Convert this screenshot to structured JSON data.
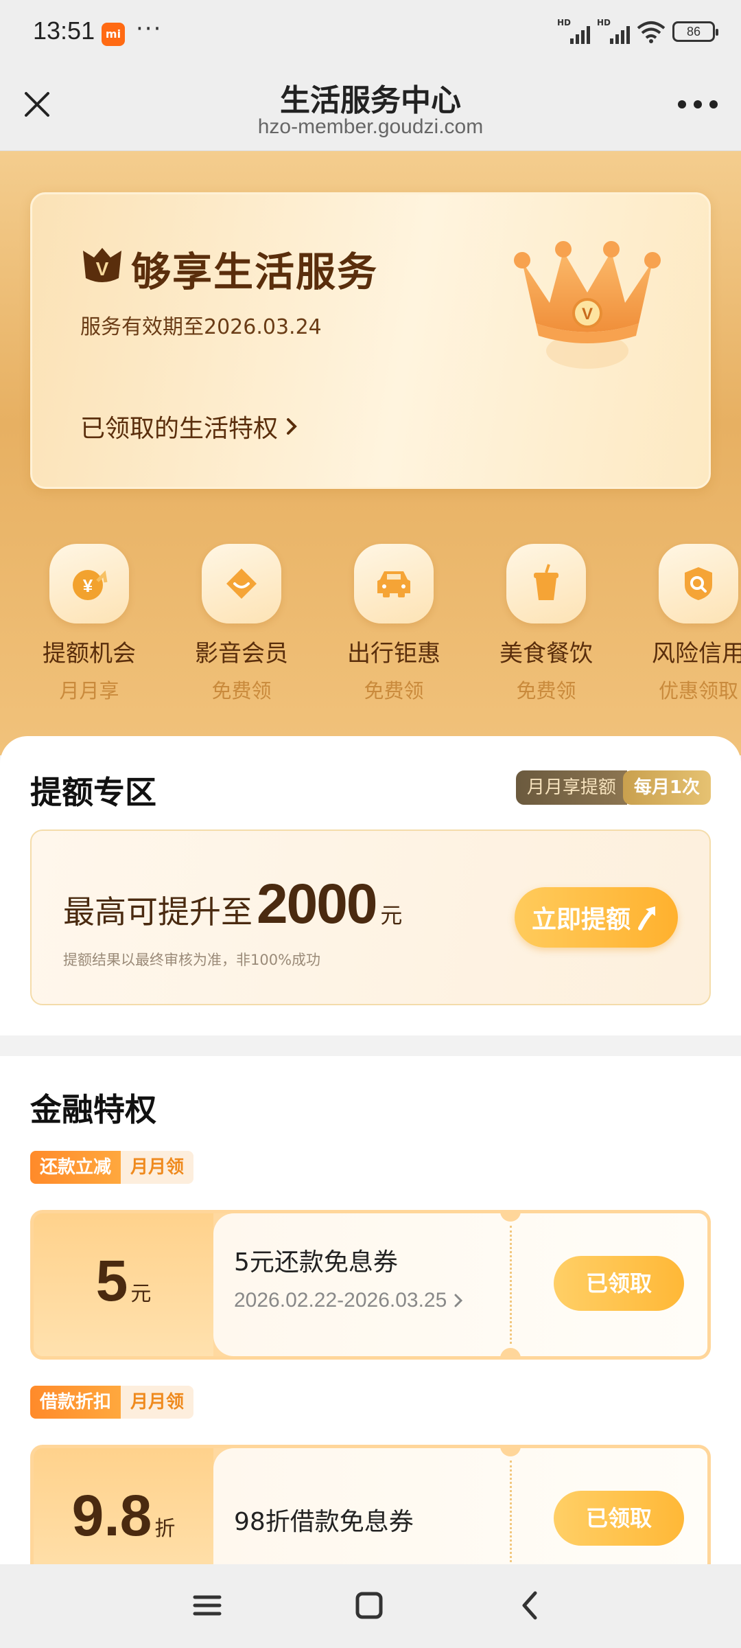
{
  "status_bar": {
    "time": "13:51",
    "mi_label": "mi",
    "more": "···",
    "signal_label": "HD",
    "battery": "86"
  },
  "header": {
    "title": "生活服务中心",
    "url": "hzo-member.goudzi.com",
    "close_icon": "close-icon",
    "more_icon": "more-dots-icon"
  },
  "hero": {
    "title": "够享生活服务",
    "validity": "服务有效期至2026.03.24",
    "link": "已领取的生活特权",
    "logo_letter": "V",
    "crown_letter": "V"
  },
  "categories": [
    {
      "name": "提额机会",
      "sub": "月月享",
      "icon": "yen-up-icon"
    },
    {
      "name": "影音会员",
      "sub": "免费领",
      "icon": "gem-icon"
    },
    {
      "name": "出行钜惠",
      "sub": "免费领",
      "icon": "car-icon"
    },
    {
      "name": "美食餐饮",
      "sub": "免费领",
      "icon": "cup-icon"
    },
    {
      "name": "风险信用",
      "sub": "优惠领取",
      "icon": "shield-search-icon"
    }
  ],
  "boost_section": {
    "title": "提额专区",
    "badge_left": "月月享提额",
    "badge_right": "每月1次",
    "prefix": "最高可提升至",
    "amount": "2000",
    "unit": "元",
    "note": "提额结果以最终审核为准，非100%成功",
    "button": "立即提额"
  },
  "finance_section": {
    "title": "金融特权",
    "coupons": [
      {
        "tag": "还款立减",
        "tag_sub": "月月领",
        "amount": "5",
        "unit": "元",
        "title": "5元还款免息券",
        "date": "2026.02.22-2026.03.25",
        "button": "已领取"
      },
      {
        "tag": "借款折扣",
        "tag_sub": "月月领",
        "amount": "9.8",
        "unit": "折",
        "title": "98折借款免息券",
        "date": "",
        "button": "已领取"
      }
    ]
  },
  "nav_bar": {
    "menu_icon": "menu-icon",
    "home_icon": "home-square-icon",
    "back_icon": "back-chevron-icon"
  },
  "colors": {
    "brand_gold": "#e7b062",
    "button_orange": "#ffb12e",
    "tag_orange": "#ff8a2a",
    "text_brown": "#5a2e0c"
  }
}
